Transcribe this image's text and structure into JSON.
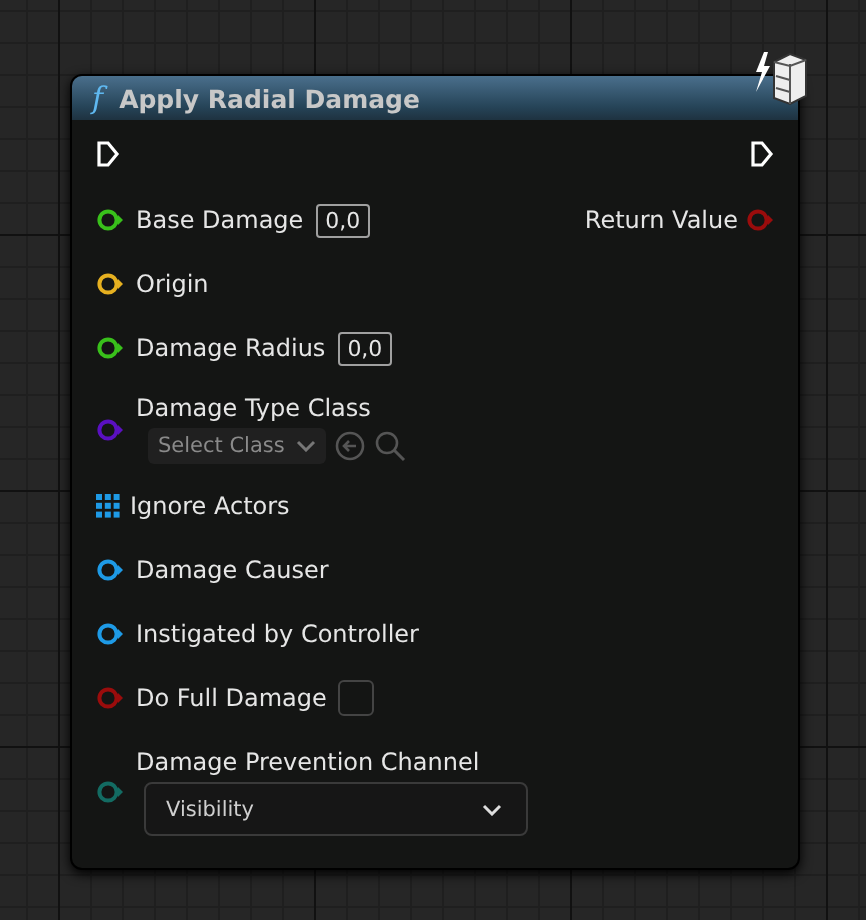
{
  "node": {
    "title": "Apply Radial Damage",
    "title_icon": "f",
    "inputs": [
      {
        "kind": "value",
        "label": "Base Damage",
        "color": "#39c01b",
        "value": "0,0"
      },
      {
        "kind": "plain",
        "label": "Origin",
        "color": "#e6b020"
      },
      {
        "kind": "value",
        "label": "Damage Radius",
        "color": "#39c01b",
        "value": "0,0"
      },
      {
        "kind": "class",
        "label": "Damage Type Class",
        "color": "#5a10c0",
        "placeholder": "Select Class"
      },
      {
        "kind": "array",
        "label": "Ignore Actors",
        "color": "#1e9ae6"
      },
      {
        "kind": "plain",
        "label": "Damage Causer",
        "color": "#1e9ae6"
      },
      {
        "kind": "plain",
        "label": "Instigated by Controller",
        "color": "#1e9ae6"
      },
      {
        "kind": "bool",
        "label": "Do Full Damage",
        "color": "#9a0c0c",
        "checked": false
      },
      {
        "kind": "enum",
        "label": "Damage Prevention Channel",
        "color": "#136b62",
        "value": "Visibility"
      }
    ],
    "outputs": [
      {
        "label": "Return Value",
        "color": "#9a0c0c"
      }
    ]
  }
}
